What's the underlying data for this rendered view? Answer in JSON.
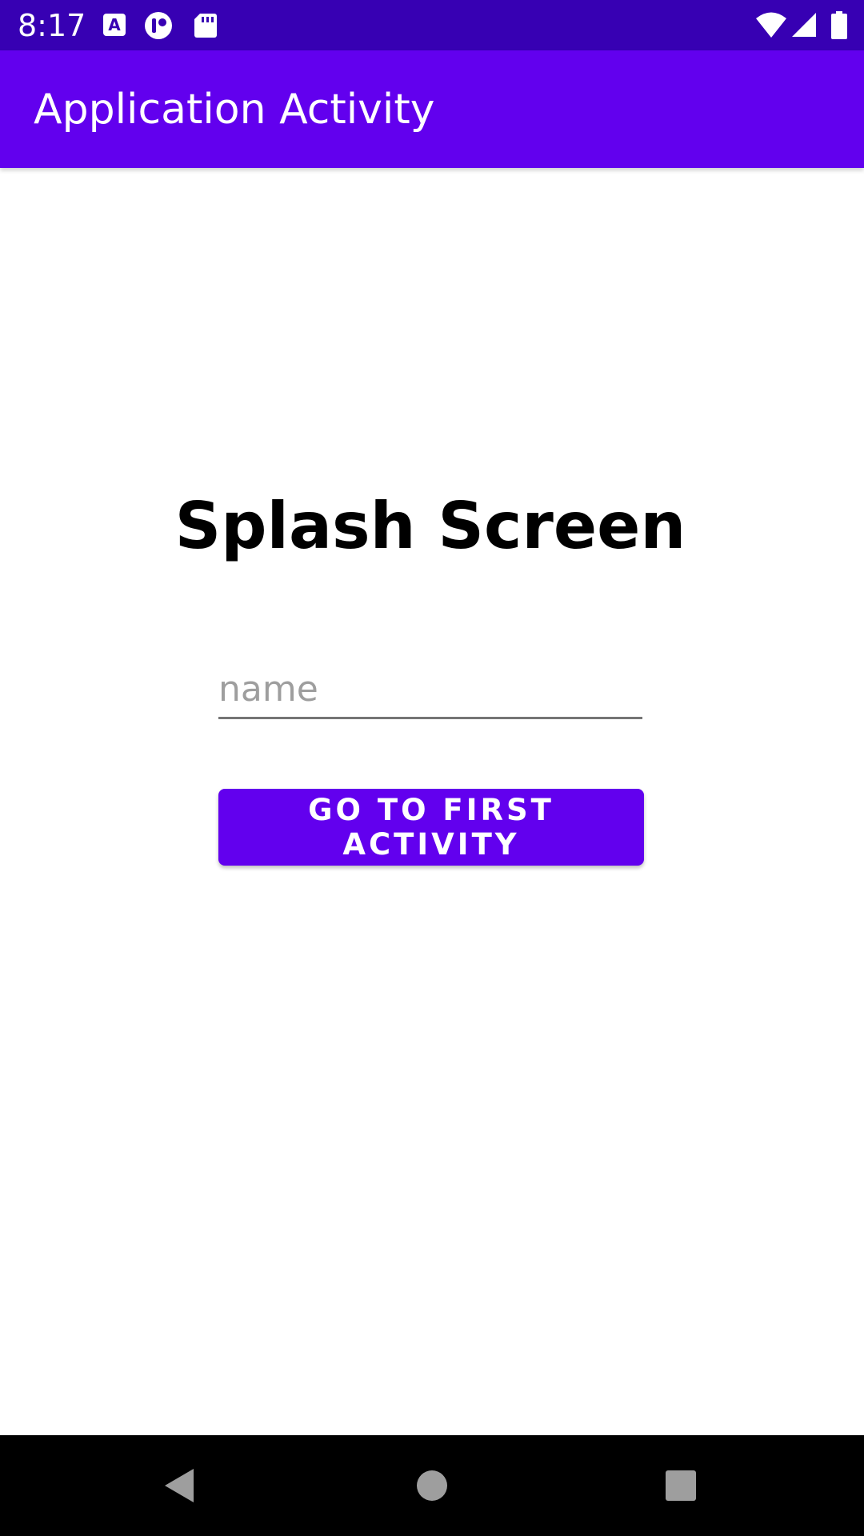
{
  "status_bar": {
    "time": "8:17",
    "icons": [
      "a-keyboard-icon",
      "notification-app-icon",
      "sd-card-icon",
      "wifi-icon",
      "signal-icon",
      "battery-icon"
    ]
  },
  "app_bar": {
    "title": "Application Activity"
  },
  "main": {
    "heading": "Splash Screen",
    "name_input": {
      "value": "",
      "placeholder": "name"
    },
    "go_button_label": "GO TO FIRST ACTIVITY"
  },
  "nav_bar": {
    "buttons": [
      "back-icon",
      "home-icon",
      "recents-icon"
    ]
  },
  "colors": {
    "status_bar": "#3700B3",
    "primary": "#6200EE"
  }
}
